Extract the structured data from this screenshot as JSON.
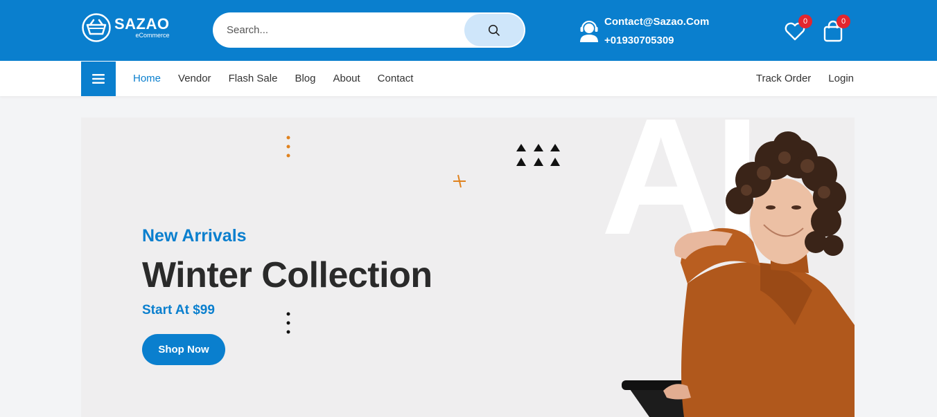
{
  "header": {
    "brand": "SAZAO",
    "tagline": "eCommerce",
    "search_placeholder": "Search...",
    "contact_email": "Contact@Sazao.Com",
    "contact_phone": "+01930705309",
    "wishlist_count": "0",
    "cart_count": "0"
  },
  "nav": {
    "items": [
      {
        "label": "Home",
        "active": true
      },
      {
        "label": "Vendor"
      },
      {
        "label": "Flash Sale"
      },
      {
        "label": "Blog"
      },
      {
        "label": "About"
      },
      {
        "label": "Contact"
      }
    ],
    "right": [
      "Track Order",
      "Login"
    ]
  },
  "hero": {
    "subtitle": "New Arrivals",
    "title": "Winter Collection",
    "price_text": "Start At $99",
    "cta_label": "Shop Now",
    "bg_letters": "AI"
  },
  "colors": {
    "primary": "#0a7fce",
    "badge": "#e3262f",
    "accent_orange": "#e0821e",
    "hero_bg": "#efeeef"
  },
  "icons": [
    "logo-basket-icon",
    "search-icon",
    "headset-icon",
    "heart-icon",
    "bag-icon",
    "hamburger-icon"
  ]
}
